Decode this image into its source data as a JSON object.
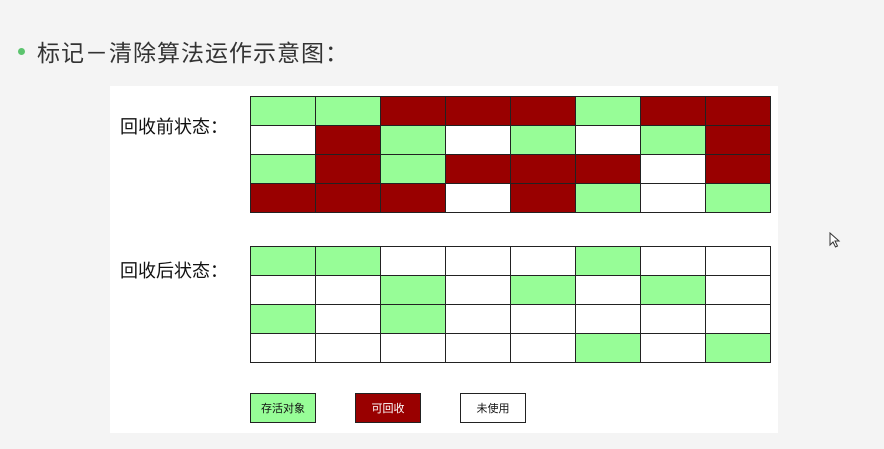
{
  "slide": {
    "title": "标记－清除算法运作示意图："
  },
  "colors": {
    "alive": "#97fd97",
    "recyclable": "#990000",
    "unused": "#ffffff",
    "bullet": "#5cc46e"
  },
  "before": {
    "label": "回收前状态：",
    "rows": [
      [
        "alive",
        "alive",
        "recyclable",
        "recyclable",
        "recyclable",
        "alive",
        "recyclable",
        "recyclable"
      ],
      [
        "unused",
        "recyclable",
        "alive",
        "unused",
        "alive",
        "unused",
        "alive",
        "recyclable"
      ],
      [
        "alive",
        "recyclable",
        "alive",
        "recyclable",
        "recyclable",
        "recyclable",
        "unused",
        "recyclable"
      ],
      [
        "recyclable",
        "recyclable",
        "recyclable",
        "unused",
        "recyclable",
        "alive",
        "unused",
        "alive"
      ]
    ]
  },
  "after": {
    "label": "回收后状态：",
    "rows": [
      [
        "alive",
        "alive",
        "unused",
        "unused",
        "unused",
        "alive",
        "unused",
        "unused"
      ],
      [
        "unused",
        "unused",
        "alive",
        "unused",
        "alive",
        "unused",
        "alive",
        "unused"
      ],
      [
        "alive",
        "unused",
        "alive",
        "unused",
        "unused",
        "unused",
        "unused",
        "unused"
      ],
      [
        "unused",
        "unused",
        "unused",
        "unused",
        "unused",
        "alive",
        "unused",
        "alive"
      ]
    ]
  },
  "legend": [
    {
      "key": "alive",
      "label": "存活对象",
      "text_color": "#111111"
    },
    {
      "key": "recyclable",
      "label": "可回收",
      "text_color": "#ffffff"
    },
    {
      "key": "unused",
      "label": "未使用",
      "text_color": "#111111"
    }
  ]
}
